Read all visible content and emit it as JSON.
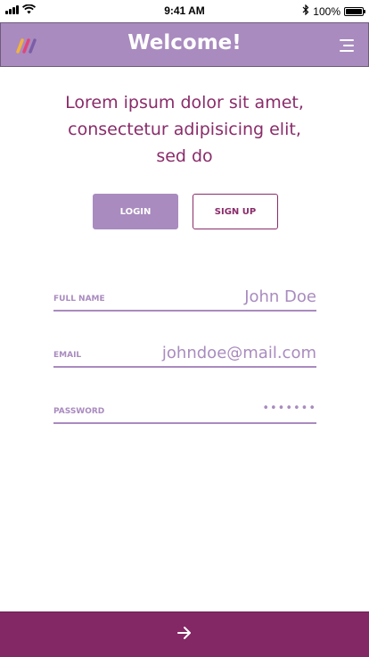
{
  "status_bar": {
    "time": "9:41 AM",
    "battery": "100%",
    "battery_level": 1.0
  },
  "header": {
    "title": "Welcome!",
    "logo_icon": "app-logo-stripes",
    "menu_icon": "hamburger-menu-icon"
  },
  "intro": {
    "text": "Lorem ipsum dolor sit amet, consectetur adipisicing elit, sed do"
  },
  "tabs": {
    "login_label": "LOGIN",
    "signup_label": "SIGN UP",
    "selected": "LOGIN"
  },
  "form": {
    "full_name": {
      "label": "FULL NAME",
      "value": "John Doe"
    },
    "email": {
      "label": "EMAIL",
      "value": "johndoe@mail.com"
    },
    "password": {
      "label": "PASSWORD",
      "value": "•••••••"
    }
  },
  "footer": {
    "submit_icon": "arrow-right-icon"
  },
  "colors": {
    "header_bg": "#a98bbf",
    "accent_dark": "#842865",
    "text_primary": "#8a2c6a",
    "field_color": "#a98bbf",
    "logo_stripes": [
      "#f2b33d",
      "#e0457b",
      "#7b5ea7"
    ]
  }
}
